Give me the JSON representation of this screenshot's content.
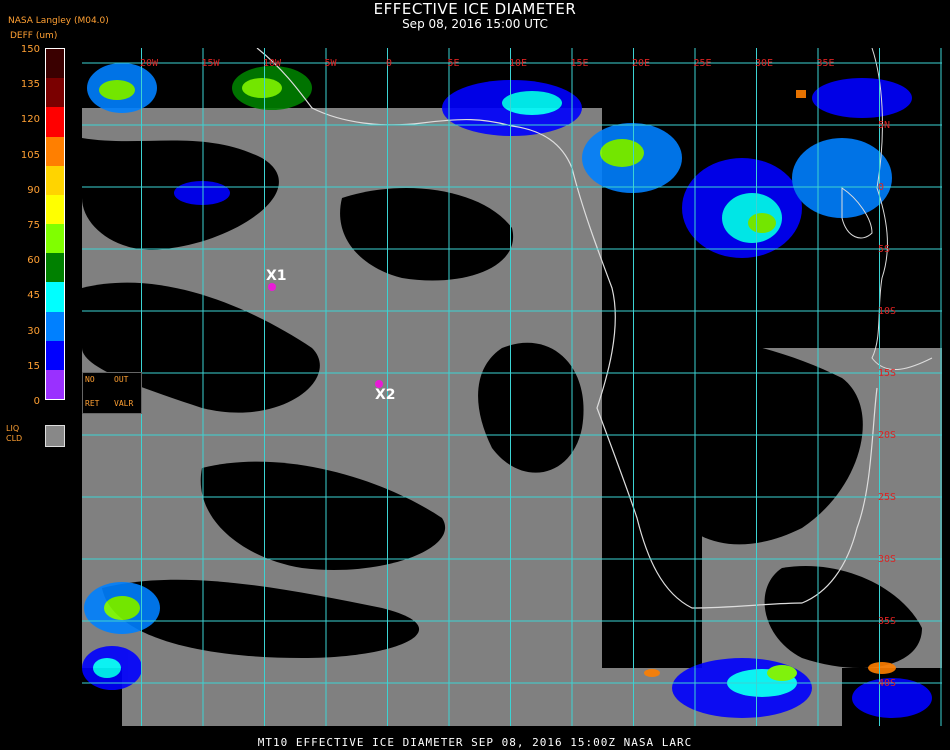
{
  "header": {
    "title": "EFFECTIVE ICE DIAMETER",
    "subtitle": "Sep 08, 2016 15:00 UTC",
    "provider": "NASA Langley (M04.0)",
    "units": "DEFF (um)"
  },
  "colorbar": {
    "ticks": [
      "150",
      "135",
      "120",
      "105",
      "90",
      "75",
      "60",
      "45",
      "30",
      "15",
      "0"
    ],
    "colors": [
      "#3a0000",
      "#7a0000",
      "#ff0000",
      "#ff7f00",
      "#ffd400",
      "#ffff00",
      "#80ff00",
      "#008000",
      "#00ffff",
      "#0080ff",
      "#0000ff",
      "#9a30ff"
    ]
  },
  "legend": {
    "no": "NO",
    "ret": "RET",
    "out": "OUT",
    "valr": "VALR",
    "liq": "LIQ",
    "cld": "CLD"
  },
  "grid": {
    "lon_labels": [
      "20W",
      "15W",
      "10W",
      "5W",
      "0",
      "5E",
      "10E",
      "15E",
      "20E",
      "25E",
      "30E",
      "35E"
    ],
    "lat_labels": [
      "5N",
      "0",
      "5S",
      "10S",
      "15S",
      "20S",
      "25S",
      "30S",
      "35S",
      "40S"
    ],
    "line_color": "#3cd3d3"
  },
  "markers": [
    {
      "label": "X1"
    },
    {
      "label": "X2"
    }
  ],
  "footer": "MT10  EFFECTIVE ICE DIAMETER  SEP 08, 2016 15:00Z  NASA LARC"
}
